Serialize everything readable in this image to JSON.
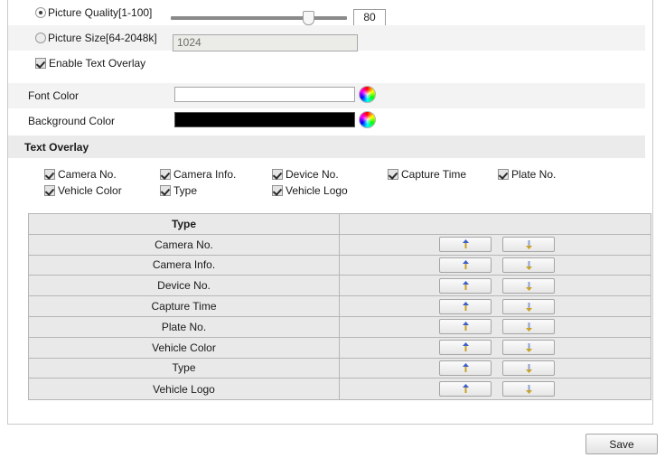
{
  "picture_quality": {
    "label": "Picture Quality[1-100]",
    "selected": true,
    "value": "80",
    "slider_percent": 80
  },
  "picture_size": {
    "label": "Picture Size[64-2048k]",
    "selected": false,
    "value": "1024"
  },
  "enable_text_overlay": {
    "label": "Enable Text Overlay",
    "checked": true
  },
  "font_color": {
    "label": "Font Color",
    "swatch_color": "#ffffff",
    "picker_icon": "color-wheel-icon"
  },
  "background_color": {
    "label": "Background Color",
    "swatch_color": "#000000",
    "picker_icon": "color-wheel-icon"
  },
  "section": {
    "title": "Text Overlay"
  },
  "overlay_checkboxes": [
    {
      "label": "Camera No.",
      "checked": true
    },
    {
      "label": "Camera Info.",
      "checked": true
    },
    {
      "label": "Device No.",
      "checked": true
    },
    {
      "label": "Capture Time",
      "checked": true
    },
    {
      "label": "Plate No.",
      "checked": true
    },
    {
      "label": "Vehicle Color",
      "checked": true
    },
    {
      "label": "Type",
      "checked": true
    },
    {
      "label": "Vehicle Logo",
      "checked": true
    }
  ],
  "table": {
    "header": "Type",
    "rows": [
      {
        "type": "Camera No."
      },
      {
        "type": "Camera Info."
      },
      {
        "type": "Device No."
      },
      {
        "type": "Capture Time"
      },
      {
        "type": "Plate No."
      },
      {
        "type": "Vehicle Color"
      },
      {
        "type": "Type"
      },
      {
        "type": "Vehicle Logo"
      }
    ],
    "move_up_icon": "arrow-up-icon",
    "move_down_icon": "arrow-down-icon"
  },
  "save": {
    "label": "Save"
  }
}
